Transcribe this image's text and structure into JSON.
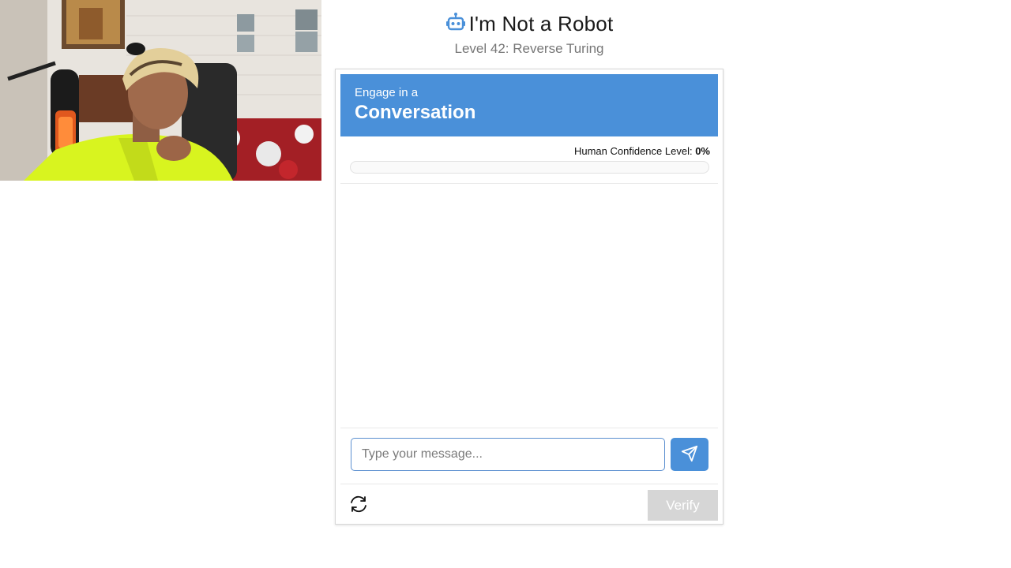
{
  "header": {
    "title": "I'm Not a Robot",
    "subtitle": "Level 42: Reverse Turing"
  },
  "card": {
    "banner_line1": "Engage in a",
    "banner_line2": "Conversation",
    "confidence_label": "Human Confidence Level:",
    "confidence_value": "0%",
    "confidence_fraction": 0,
    "input_placeholder": "Type your message...",
    "input_value": "",
    "verify_label": "Verify",
    "verify_enabled": false
  },
  "icons": {
    "title_icon": "robot-icon",
    "send_icon": "paper-plane-icon",
    "refresh_icon": "refresh-icon"
  },
  "colors": {
    "accent": "#4a90d9",
    "disabled": "#d6d6d6"
  }
}
